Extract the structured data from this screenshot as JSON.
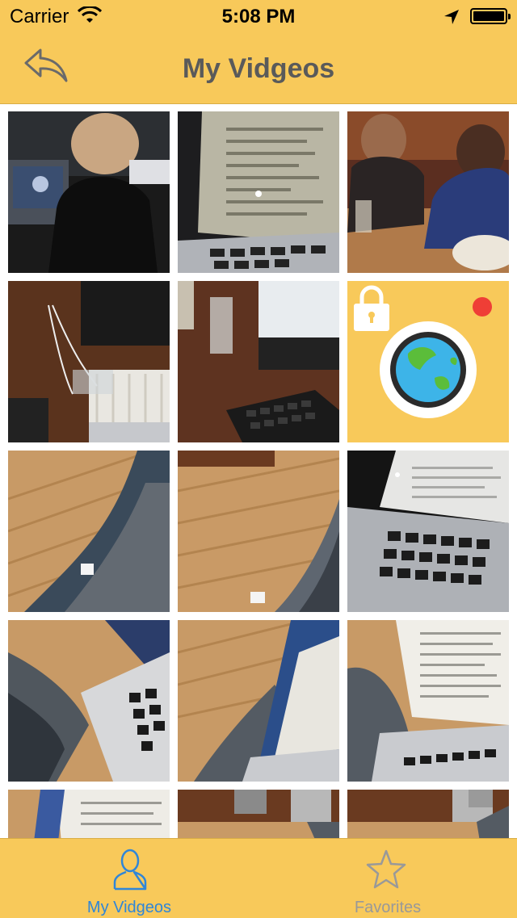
{
  "status_bar": {
    "carrier": "Carrier",
    "time": "5:08 PM"
  },
  "nav": {
    "title": "My Vidgeos"
  },
  "tabs": [
    {
      "label": "My Vidgeos",
      "active": true
    },
    {
      "label": "Favorites",
      "active": false
    }
  ],
  "colors": {
    "accent": "#f8c95a",
    "active_tab": "#2f86d8",
    "inactive_tab": "#999999"
  }
}
